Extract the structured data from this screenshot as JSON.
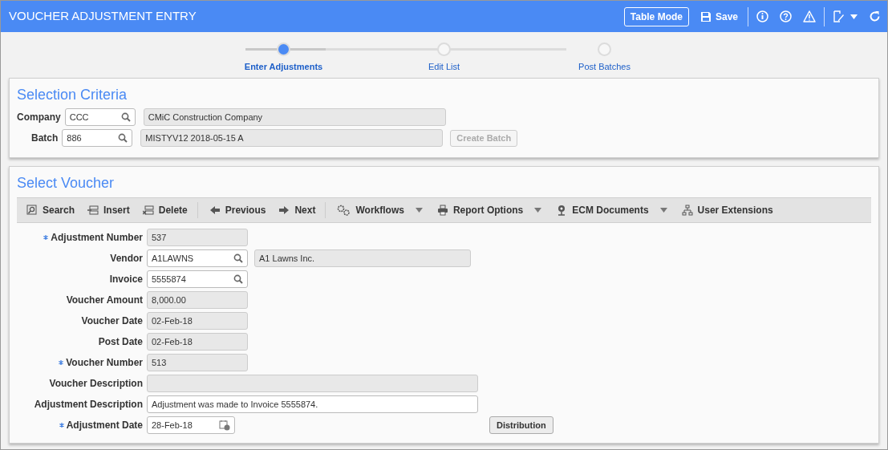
{
  "header": {
    "title": "VOUCHER ADJUSTMENT ENTRY",
    "table_mode": "Table Mode",
    "save": "Save"
  },
  "stepper": {
    "level": 0.25,
    "steps": [
      {
        "label": "Enter Adjustments",
        "selected": true
      },
      {
        "label": "Edit List",
        "selected": false
      },
      {
        "label": "Post Batches",
        "selected": false
      }
    ]
  },
  "selection_criteria": {
    "title": "Selection Criteria",
    "rows": [
      {
        "label": "Company",
        "code": "CCC",
        "description": "CMiC Construction Company"
      },
      {
        "label": "Batch",
        "code": "886",
        "description": "MISTYV12 2018-05-15 A",
        "button": {
          "label": "Create Batch",
          "disabled": true
        }
      }
    ]
  },
  "select_voucher": {
    "title": "Select Voucher",
    "toolbar": [
      {
        "label": "Search",
        "dropdown": false,
        "separator_after": false
      },
      {
        "label": "Insert",
        "dropdown": false,
        "separator_after": false
      },
      {
        "label": "Delete",
        "dropdown": false,
        "separator_after": true
      },
      {
        "label": "Previous",
        "dropdown": false,
        "separator_after": false
      },
      {
        "label": "Next",
        "dropdown": false,
        "separator_after": true
      },
      {
        "label": "Workflows",
        "dropdown": true,
        "separator_after": false
      },
      {
        "label": "Report Options",
        "dropdown": true,
        "separator_after": false
      },
      {
        "label": "ECM Documents",
        "dropdown": true,
        "separator_after": false
      },
      {
        "label": "User Extensions",
        "dropdown": false,
        "separator_after": false
      }
    ],
    "fields": [
      {
        "label": "Adjustment Number",
        "required": true,
        "kind": "readonly",
        "value": "537"
      },
      {
        "label": "Vendor",
        "required": false,
        "kind": "lookup",
        "value": "A1LAWNS",
        "description": "A1 Lawns Inc."
      },
      {
        "label": "Invoice",
        "required": false,
        "kind": "lookup",
        "value": "5555874"
      },
      {
        "label": "Voucher Amount",
        "required": false,
        "kind": "readonly",
        "value": "8,000.00"
      },
      {
        "label": "Voucher Date",
        "required": false,
        "kind": "readonly",
        "value": "02-Feb-18"
      },
      {
        "label": "Post Date",
        "required": false,
        "kind": "readonly",
        "value": "02-Feb-18"
      },
      {
        "label": "Voucher Number",
        "required": true,
        "kind": "readonly",
        "value": "513"
      },
      {
        "label": "Voucher Description",
        "required": false,
        "kind": "readonly_wide"
      },
      {
        "label": "Adjustment Description",
        "required": false,
        "kind": "text_wide",
        "value": "Adjustment was made to Invoice 5555874."
      },
      {
        "label": "Adjustment Date",
        "required": true,
        "kind": "date",
        "value": "28-Feb-18",
        "button": "Distribution"
      }
    ]
  }
}
